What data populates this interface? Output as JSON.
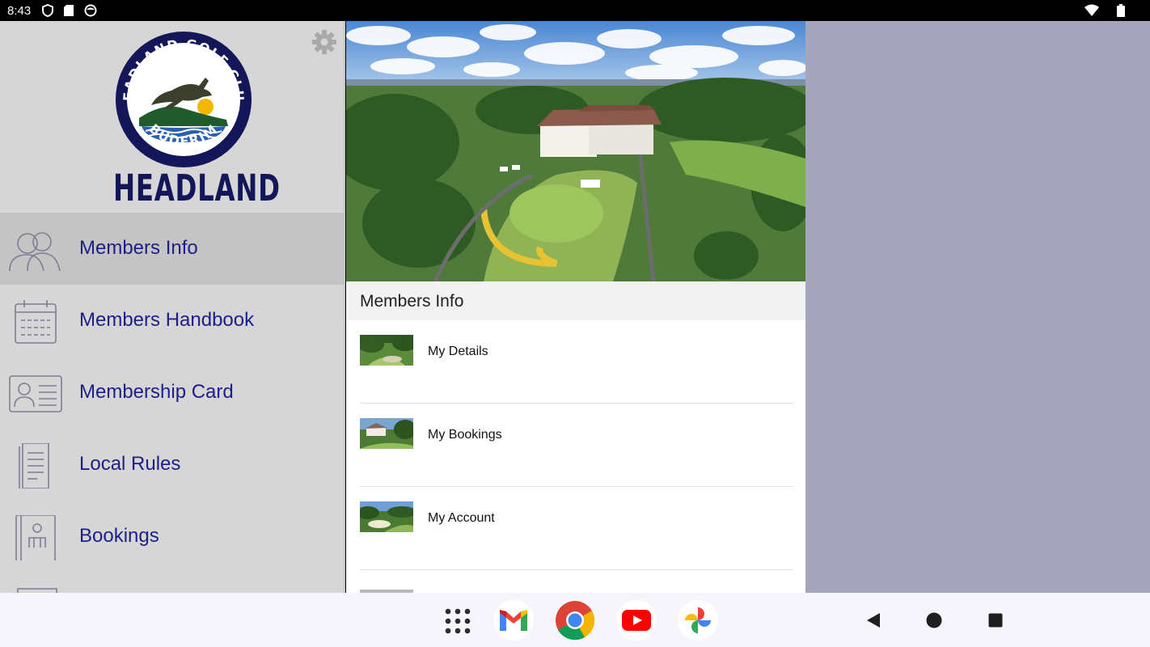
{
  "status_bar": {
    "time": "8:43",
    "left_icons": [
      "shield-icon",
      "sd-card-icon",
      "face-icon"
    ],
    "right_icons": [
      "wifi-icon",
      "battery-icon"
    ]
  },
  "club": {
    "name": "HEADLAND GOLF CLUB",
    "location": "BUDERIM",
    "wordmark": "HEADLAND",
    "brand_color": "#14165a"
  },
  "sidebar": {
    "settings_icon": "gear-icon",
    "items": [
      {
        "label": "Members Info",
        "icon": "members-icon",
        "active": true
      },
      {
        "label": "Members Handbook",
        "icon": "calendar-icon",
        "active": false
      },
      {
        "label": "Membership Card",
        "icon": "id-card-icon",
        "active": false
      },
      {
        "label": "Local Rules",
        "icon": "document-icon",
        "active": false
      },
      {
        "label": "Bookings",
        "icon": "bookings-icon",
        "active": false
      }
    ],
    "label_color": "#1d1f86"
  },
  "main": {
    "section_title": "Members Info",
    "list": [
      {
        "label": "My Details"
      },
      {
        "label": "My Bookings"
      },
      {
        "label": "My Account"
      }
    ]
  },
  "nav_bar": {
    "dock_apps": [
      "app-drawer-icon",
      "gmail-icon",
      "chrome-icon",
      "youtube-icon",
      "photos-icon"
    ],
    "buttons": [
      "back-icon",
      "home-icon",
      "recents-icon"
    ]
  }
}
